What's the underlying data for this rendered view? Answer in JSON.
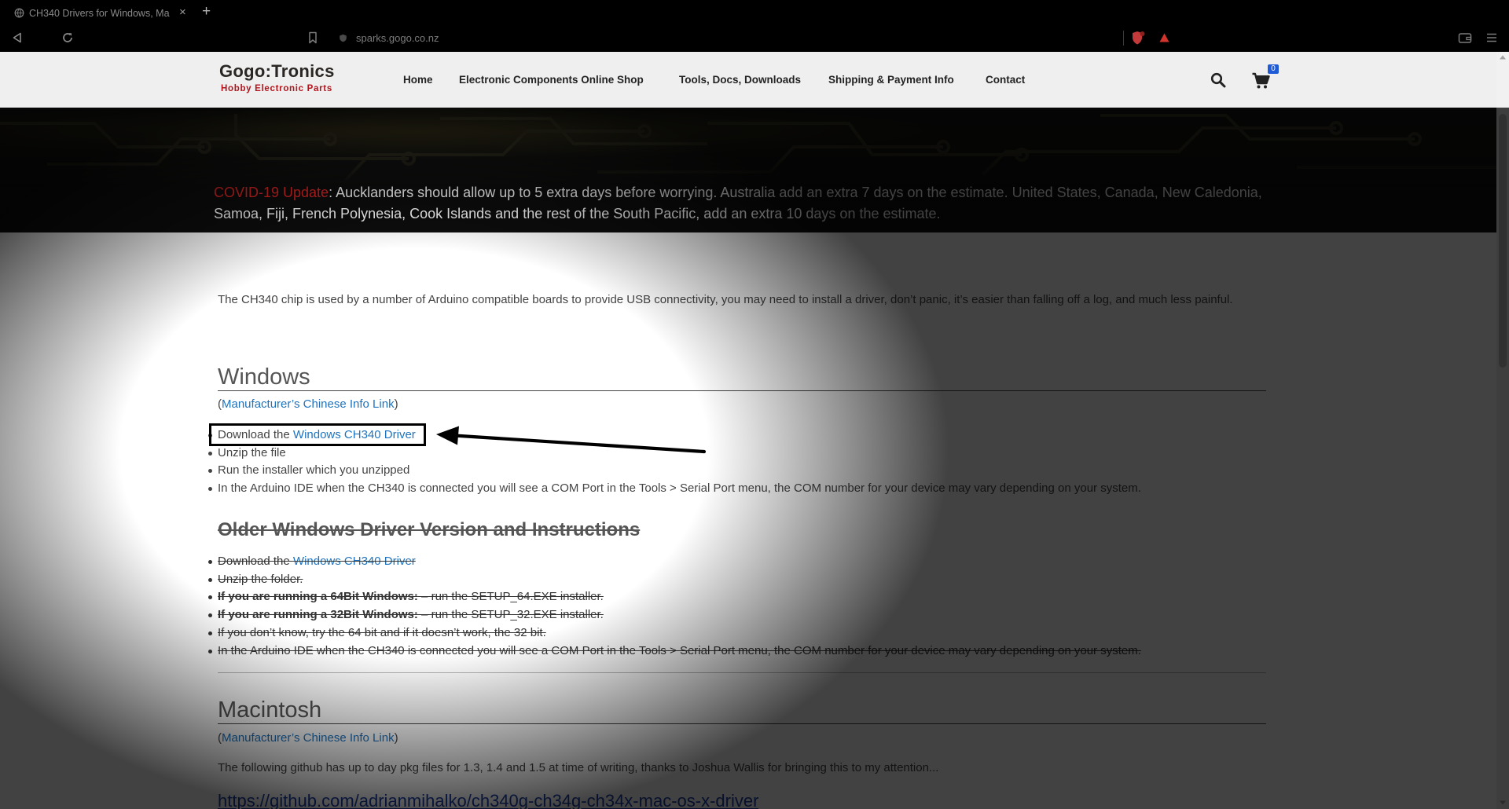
{
  "browser": {
    "tab_title": "CH340 Drivers for Windows, Ma",
    "tab_close": "×",
    "new_tab": "+",
    "url": "sparks.gogo.co.nz"
  },
  "header": {
    "logo_title": "Gogo:Tronics",
    "logo_subtitle": "Hobby Electronic Parts",
    "nav": [
      "Home",
      "Electronic Components Online Shop",
      "Tools, Docs, Downloads",
      "Shipping & Payment Info",
      "Contact"
    ],
    "cart_count": "0"
  },
  "banner": {
    "alert_label": "COVID-19 Update",
    "line1_rest": ": Aucklanders should allow up to 5 extra days before worrying. Australia add an extra 7 days on the estimate. United States, Canada, New Caledonia,",
    "line2": "Samoa, Fiji, French Polynesia, Cook Islands and the rest of the South Pacific, add an extra 10 days on the estimate."
  },
  "intro": "The CH340 chip is used by a number of Arduino compatible boards to provide USB connectivity, you may need to install a driver, don’t panic, it’s easier than falling off a log, and much less painful.",
  "windows": {
    "heading": "Windows",
    "info_open": "(",
    "info_link": "Manufacturer’s Chinese Info Link",
    "info_close": ")",
    "steps": [
      {
        "text": "Download the ",
        "link": "Windows CH340 Driver"
      },
      {
        "text": "Unzip the file"
      },
      {
        "text": "Run the installer which you unzipped"
      },
      {
        "text": "In the Arduino IDE when the CH340 is connected you will see a COM Port in the Tools > Serial Port menu, the COM number for your device may vary depending on your system."
      }
    ]
  },
  "older_windows": {
    "heading": "Older Windows Driver Version and Instructions",
    "steps": [
      {
        "text": "Download the ",
        "link": "Windows CH340 Driver"
      },
      {
        "text": "Unzip the folder."
      },
      {
        "bold": "If you are running a 64Bit Windows:",
        "text": " – run the SETUP_64.EXE installer."
      },
      {
        "bold": "If you are running a 32Bit Windows:",
        "text": " – run the SETUP_32.EXE installer."
      },
      {
        "text": "If you don’t know, try the 64 bit and if it doesn’t work, the 32 bit."
      },
      {
        "text": "In the Arduino IDE when the CH340 is connected you will see a COM Port in the Tools > Serial Port menu, the COM number for your device may vary depending on your system."
      }
    ]
  },
  "mac": {
    "heading": "Macintosh",
    "info_open": "(",
    "info_link": "Manufacturer’s Chinese Info Link",
    "info_close": ")",
    "text": "The following github has up to day pkg files for 1.3, 1.4 and 1.5 at time of writing, thanks to Joshua Wallis for bringing this to my attention...",
    "github_link": "https://github.com/adrianmihalko/ch340g-ch34g-ch34x-mac-os-x-driver"
  },
  "icons": {
    "favicon": "globe-icon",
    "back": "back-arrow-icon",
    "reload": "reload-icon",
    "bookmark": "bookmark-icon",
    "site_info": "site-info-icon",
    "shield": "shield-extension-icon",
    "rewards": "triangle-extension-icon",
    "wallet": "wallet-icon",
    "menu": "menu-icon",
    "search": "search-icon",
    "cart": "cart-icon"
  },
  "colors": {
    "link": "#1e73be",
    "alert": "#e32626",
    "cart_badge": "#1f5bd6",
    "logo_subtitle": "#b3141c"
  }
}
